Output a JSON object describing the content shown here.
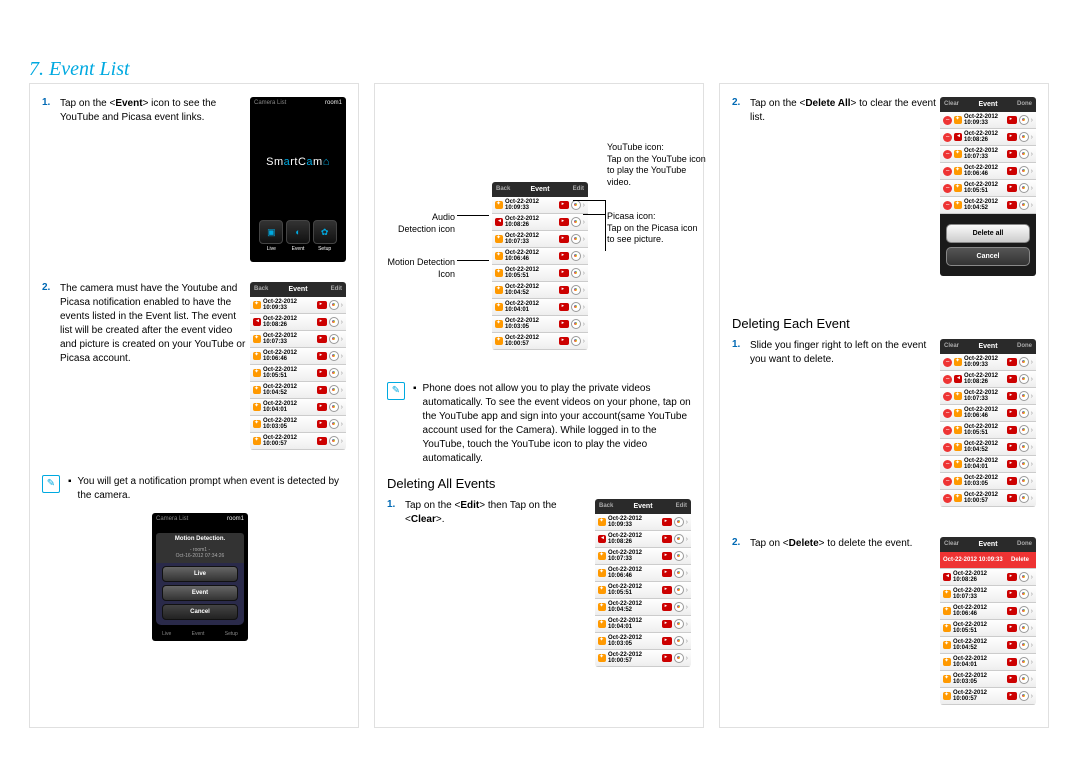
{
  "page_title": "7. Event List",
  "col1": {
    "step1": {
      "num": "1.",
      "text_before": "Tap on the <",
      "bold": "Event",
      "text_after": "> icon to see the YouTube and Picasa event links."
    },
    "screenshot1": {
      "header_left": "Camera List",
      "header_right": "room1",
      "logo": "SmartCam",
      "tabs": [
        "Live",
        "Event",
        "Setup"
      ]
    },
    "step2": {
      "num": "2.",
      "text": "The camera must have the Youtube and Picasa notification enabled to have the events listed in the Event list. The event list will be created after the event video and picture is created on your YouTube or Picasa account."
    },
    "screenshot2": {
      "header_left": "Back",
      "header_mid": "Event",
      "header_right": "Edit",
      "rows": [
        {
          "icon": "run",
          "ts": "Oct-22-2012 10:09:33"
        },
        {
          "icon": "audio",
          "ts": "Oct-22-2012 10:08:26"
        },
        {
          "icon": "run",
          "ts": "Oct-22-2012 10:07:33"
        },
        {
          "icon": "run",
          "ts": "Oct-22-2012 10:06:46"
        },
        {
          "icon": "run",
          "ts": "Oct-22-2012 10:05:51"
        },
        {
          "icon": "run",
          "ts": "Oct-22-2012 10:04:52"
        },
        {
          "icon": "run",
          "ts": "Oct-22-2012 10:04:01"
        },
        {
          "icon": "run",
          "ts": "Oct-22-2012 10:03:05"
        },
        {
          "icon": "run",
          "ts": "Oct-22-2012 10:00:57"
        }
      ]
    },
    "note": "You will get a notification prompt when event is detected by the camera.",
    "screenshot3": {
      "header_left": "Camera List",
      "header_right": "room1",
      "title": "Motion Detection.",
      "subtitle_line1": "- room1 -",
      "subtitle_line2": "Oct-16-2012 07:34:26",
      "buttons": [
        "Live",
        "Event",
        "Cancel"
      ],
      "tabs": [
        "Live",
        "Event",
        "Setup"
      ]
    }
  },
  "col2": {
    "callouts": {
      "yt_title": "YouTube icon:",
      "yt_text": "Tap on the YouTube icon to play the YouTube video.",
      "picasa_title": "Picasa icon:",
      "picasa_text": "Tap on the Picasa icon to see picture.",
      "audio": "Audio Detection icon",
      "motion": "Motion Detection Icon"
    },
    "screenshot1": {
      "header_left": "Back",
      "header_mid": "Event",
      "header_right": "Edit"
    },
    "note": "Phone does not allow you to play the private videos automatically. To see the event videos on your phone, tap on the YouTube app and sign into your account(same YouTube account used for the Camera). While logged in to the YouTube, touch the YouTube icon to play the video automatically.",
    "section_title": "Deleting All Events",
    "step1": {
      "num": "1.",
      "text_before": "Tap on the <",
      "bold1": "Edit",
      "mid": "> then Tap on the <",
      "bold2": "Clear",
      "text_after": ">."
    },
    "screenshot2": {
      "header_left": "Back",
      "header_mid": "Event",
      "header_right": "Edit"
    }
  },
  "col3": {
    "step2top": {
      "num": "2.",
      "text_before": "Tap on the <",
      "bold": "Delete All",
      "text_after": "> to clear the event list."
    },
    "screenshot1": {
      "header_left": "Clear",
      "header_mid": "Event",
      "header_right": "Done",
      "action_buttons": [
        "Delete all",
        "Cancel"
      ]
    },
    "section_title": "Deleting Each Event",
    "step1": {
      "num": "1.",
      "text": "Slide you finger right to left on the event you want to delete."
    },
    "screenshot2": {
      "header_left": "Clear",
      "header_mid": "Event",
      "header_right": "Done"
    },
    "step2": {
      "num": "2.",
      "text_before": "Tap on <",
      "bold": "Delete",
      "text_after": "> to delete the event."
    },
    "screenshot3": {
      "header_left": "Clear",
      "header_mid": "Event",
      "header_right": "Done",
      "delete_label": "Delete"
    }
  },
  "event_rows_common": [
    {
      "icon": "run",
      "ts": "Oct-22-2012 10:09:33"
    },
    {
      "icon": "audio",
      "ts": "Oct-22-2012 10:08:26"
    },
    {
      "icon": "run",
      "ts": "Oct-22-2012 10:07:33"
    },
    {
      "icon": "run",
      "ts": "Oct-22-2012 10:06:46"
    },
    {
      "icon": "run",
      "ts": "Oct-22-2012 10:05:51"
    },
    {
      "icon": "run",
      "ts": "Oct-22-2012 10:04:52"
    },
    {
      "icon": "run",
      "ts": "Oct-22-2012 10:04:01"
    },
    {
      "icon": "run",
      "ts": "Oct-22-2012 10:03:05"
    },
    {
      "icon": "run",
      "ts": "Oct-22-2012 10:00:57"
    }
  ]
}
